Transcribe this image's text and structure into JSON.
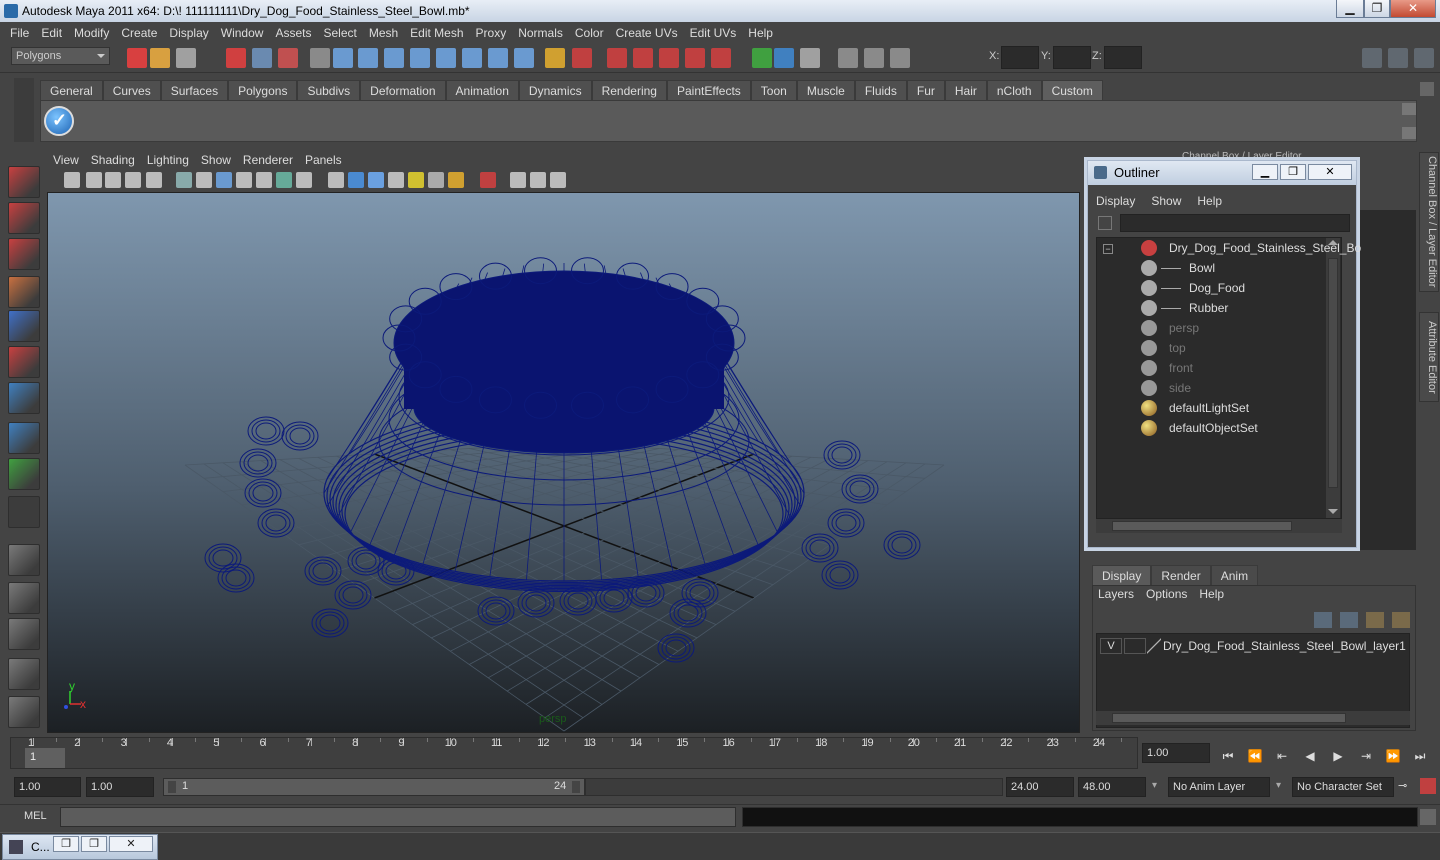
{
  "window": {
    "title": "Autodesk Maya 2011 x64: D:\\! 111111111\\Dry_Dog_Food_Stainless_Steel_Bowl.mb*",
    "minimize": "▁",
    "maximize": "❐",
    "close": "✕"
  },
  "menubar": [
    "File",
    "Edit",
    "Modify",
    "Create",
    "Display",
    "Window",
    "Assets",
    "Select",
    "Mesh",
    "Edit Mesh",
    "Proxy",
    "Normals",
    "Color",
    "Create UVs",
    "Edit UVs",
    "Help"
  ],
  "status": {
    "mode": "Polygons",
    "x_label": "X:",
    "y_label": "Y:",
    "z_label": "Z:"
  },
  "shelf": {
    "tabs": [
      "General",
      "Curves",
      "Surfaces",
      "Polygons",
      "Subdivs",
      "Deformation",
      "Animation",
      "Dynamics",
      "Rendering",
      "PaintEffects",
      "Toon",
      "Muscle",
      "Fluids",
      "Fur",
      "Hair",
      "nCloth",
      "Custom"
    ],
    "active": "Custom"
  },
  "panel": {
    "menu": [
      "View",
      "Shading",
      "Lighting",
      "Show",
      "Renderer",
      "Panels"
    ],
    "camera": "persp",
    "axis_y": "y",
    "axis_x": "x"
  },
  "outliner": {
    "title": "Outliner",
    "menu": [
      "Display",
      "Show",
      "Help"
    ],
    "items": [
      {
        "label": "Dry_Dog_Food_Stainless_Steel_Bo",
        "indent": 0,
        "dim": false
      },
      {
        "label": "Bowl",
        "indent": 1,
        "dim": false
      },
      {
        "label": "Dog_Food",
        "indent": 1,
        "dim": false
      },
      {
        "label": "Rubber",
        "indent": 1,
        "dim": false
      },
      {
        "label": "persp",
        "indent": 0,
        "dim": true
      },
      {
        "label": "top",
        "indent": 0,
        "dim": true
      },
      {
        "label": "front",
        "indent": 0,
        "dim": true
      },
      {
        "label": "side",
        "indent": 0,
        "dim": true
      },
      {
        "label": "defaultLightSet",
        "indent": 0,
        "dim": false
      },
      {
        "label": "defaultObjectSet",
        "indent": 0,
        "dim": false
      }
    ]
  },
  "channelbox": {
    "label": "Channel Box / Layer Editor",
    "attr_tab": "Attribute Editor"
  },
  "layers": {
    "tabs": [
      "Display",
      "Render",
      "Anim"
    ],
    "active": "Display",
    "menu": [
      "Layers",
      "Options",
      "Help"
    ],
    "visible": "V",
    "layer_name": "Dry_Dog_Food_Stainless_Steel_Bowl_layer1"
  },
  "timeline": {
    "frames": [
      "1",
      "2",
      "3",
      "4",
      "5",
      "6",
      "7",
      "8",
      "9",
      "10",
      "11",
      "12",
      "13",
      "14",
      "15",
      "16",
      "17",
      "18",
      "19",
      "20",
      "21",
      "22",
      "23",
      "24"
    ],
    "current": "1",
    "current_time": "1.00"
  },
  "range": {
    "start": "1.00",
    "inner_start": "1.00",
    "bar_start": "1",
    "bar_end": "24",
    "end": "24.00",
    "max": "48.00",
    "anim_layer": "No Anim Layer",
    "char_set": "No Character Set"
  },
  "cmd": {
    "label": "MEL"
  },
  "taskbar": {
    "label": "C..."
  }
}
